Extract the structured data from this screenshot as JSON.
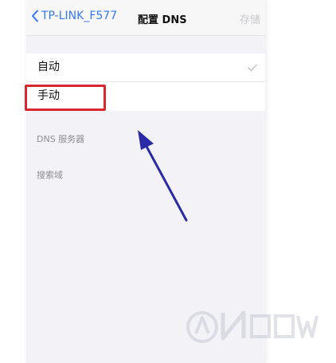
{
  "navbar": {
    "back_label": "TP-LINK_F577",
    "title": "配置 DNS",
    "save_label": "存储"
  },
  "options": [
    {
      "label": "自动",
      "checked": true
    },
    {
      "label": "手动",
      "checked": false
    }
  ],
  "sections": {
    "dns_servers": "DNS 服务器",
    "search_domains": "搜索域"
  },
  "colors": {
    "accent": "#3478f6",
    "highlight": "#d8272e",
    "arrow": "#2b2aa8"
  }
}
